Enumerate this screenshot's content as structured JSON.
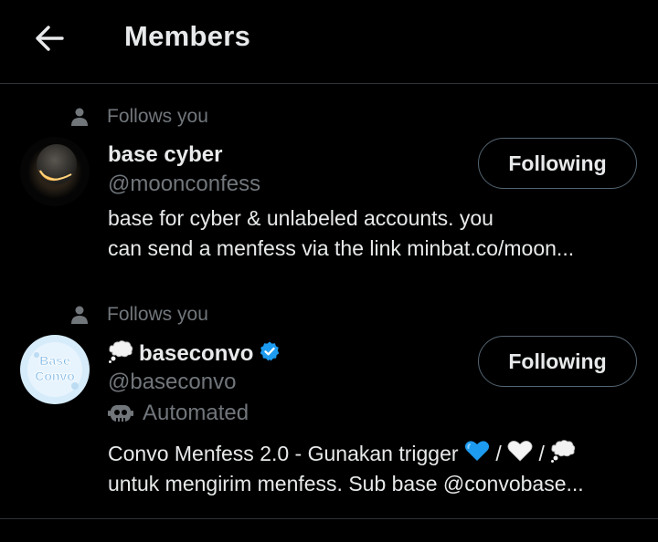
{
  "header": {
    "title": "Members"
  },
  "members": [
    {
      "follows_label": "Follows you",
      "name": "base cyber",
      "handle": "@moonconfess",
      "bio_line1": "base for cyber & unlabeled accounts. you",
      "bio_line2": "can send a menfess via the link minbat.co/moon...",
      "button_label": "Following"
    },
    {
      "follows_label": "Follows you",
      "name": "baseconvo",
      "name_emoji": "thought-balloon-icon",
      "verified": true,
      "handle": "@baseconvo",
      "automated_label": "Automated",
      "bio_line1_text": "Convo Menfess 2.0 - Gunakan trigger",
      "bio_line1_sep1": "/",
      "bio_line1_sep2": "/",
      "bio_line2": "untuk mengirim menfess. Sub base @convobase...",
      "trigger_icons": [
        "blue-heart-icon",
        "white-heart-icon",
        "thought-balloon-icon"
      ],
      "button_label": "Following",
      "avatar_text": "Base Convo"
    }
  ],
  "colors": {
    "background": "#000000",
    "text": "#e7e9ea",
    "secondary": "#71767b",
    "verified": "#1d9bf0",
    "divider": "#2f3336"
  }
}
